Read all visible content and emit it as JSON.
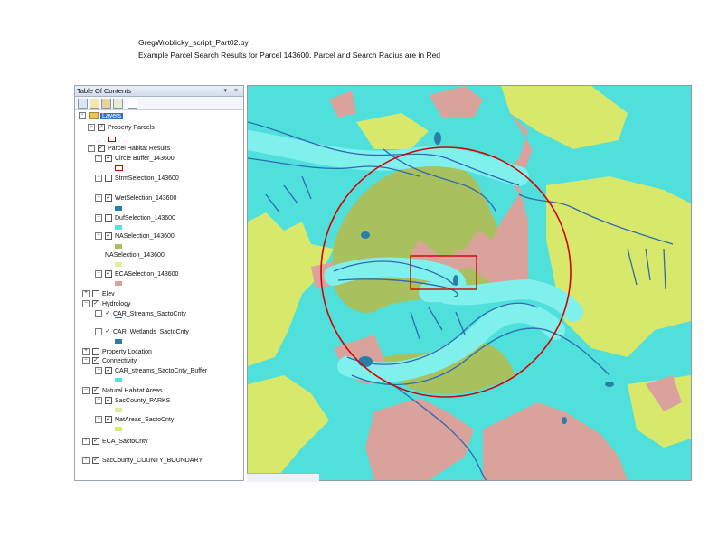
{
  "caption": {
    "line1": "GregWroblicky_script_Part02.py",
    "line2": "Example Parcel Search Results for Parcel 143600. Parcel and Search Radius are in Red"
  },
  "toc": {
    "title": "Table Of Contents",
    "controls": "▾ ×",
    "rows": [
      {
        "label": "Layers",
        "exp": "−",
        "chk": ""
      },
      {
        "label": "Property Parcels",
        "exp": "−",
        "chk": "✓"
      },
      {
        "label": "Parcel Habitat Results",
        "exp": "−",
        "chk": "✓"
      },
      {
        "label": "Circle Buffer_143600",
        "exp": "−",
        "chk": "✓"
      },
      {
        "label": "StrmSelection_143600",
        "exp": "−",
        "chk": ""
      },
      {
        "label": "WetSelection_143600",
        "exp": "−",
        "chk": "✓"
      },
      {
        "label": "DufSelection_143600",
        "exp": "−",
        "chk": ""
      },
      {
        "label": "NASelection_143600",
        "exp": "−",
        "chk": "✓"
      },
      {
        "label": "NASelection_143600",
        "exp": "",
        "chk": ""
      },
      {
        "label": "ECASelection_143600",
        "exp": "−",
        "chk": "✓"
      },
      {
        "label": "Elev",
        "exp": "+",
        "chk": ""
      },
      {
        "label": "Hydrology",
        "exp": "−",
        "chk": "✓"
      },
      {
        "label": "CAR_Streams_SactoCnty",
        "exp": "",
        "chk": ""
      },
      {
        "label": "CAR_Wetlands_SactoCnty",
        "exp": "",
        "chk": ""
      },
      {
        "label": "Property Location",
        "exp": "+",
        "chk": ""
      },
      {
        "label": "Connectivity",
        "exp": "−",
        "chk": "✓"
      },
      {
        "label": "CAR_streams_SactoCnty_Buffer",
        "exp": "−",
        "chk": "✓"
      },
      {
        "label": "Natural Habitat Areas",
        "exp": "−",
        "chk": "✓"
      },
      {
        "label": "SacCounty_PARKS",
        "exp": "−",
        "chk": "✓"
      },
      {
        "label": "NatAreas_SactoCnty",
        "exp": "−",
        "chk": "✓"
      },
      {
        "label": "ECA_SactoCnty",
        "exp": "+",
        "chk": "✓"
      },
      {
        "label": "SacCounty_COUNTY_BOUNDARY",
        "exp": "+",
        "chk": "✓"
      }
    ]
  },
  "map": {
    "colors": {
      "buffer": "#55e3df",
      "natural": "#d8e86a",
      "selection": "#a9c05e",
      "parcel": "#d9a29b",
      "stream": "#2f69b0",
      "radius": "#d40000"
    }
  }
}
